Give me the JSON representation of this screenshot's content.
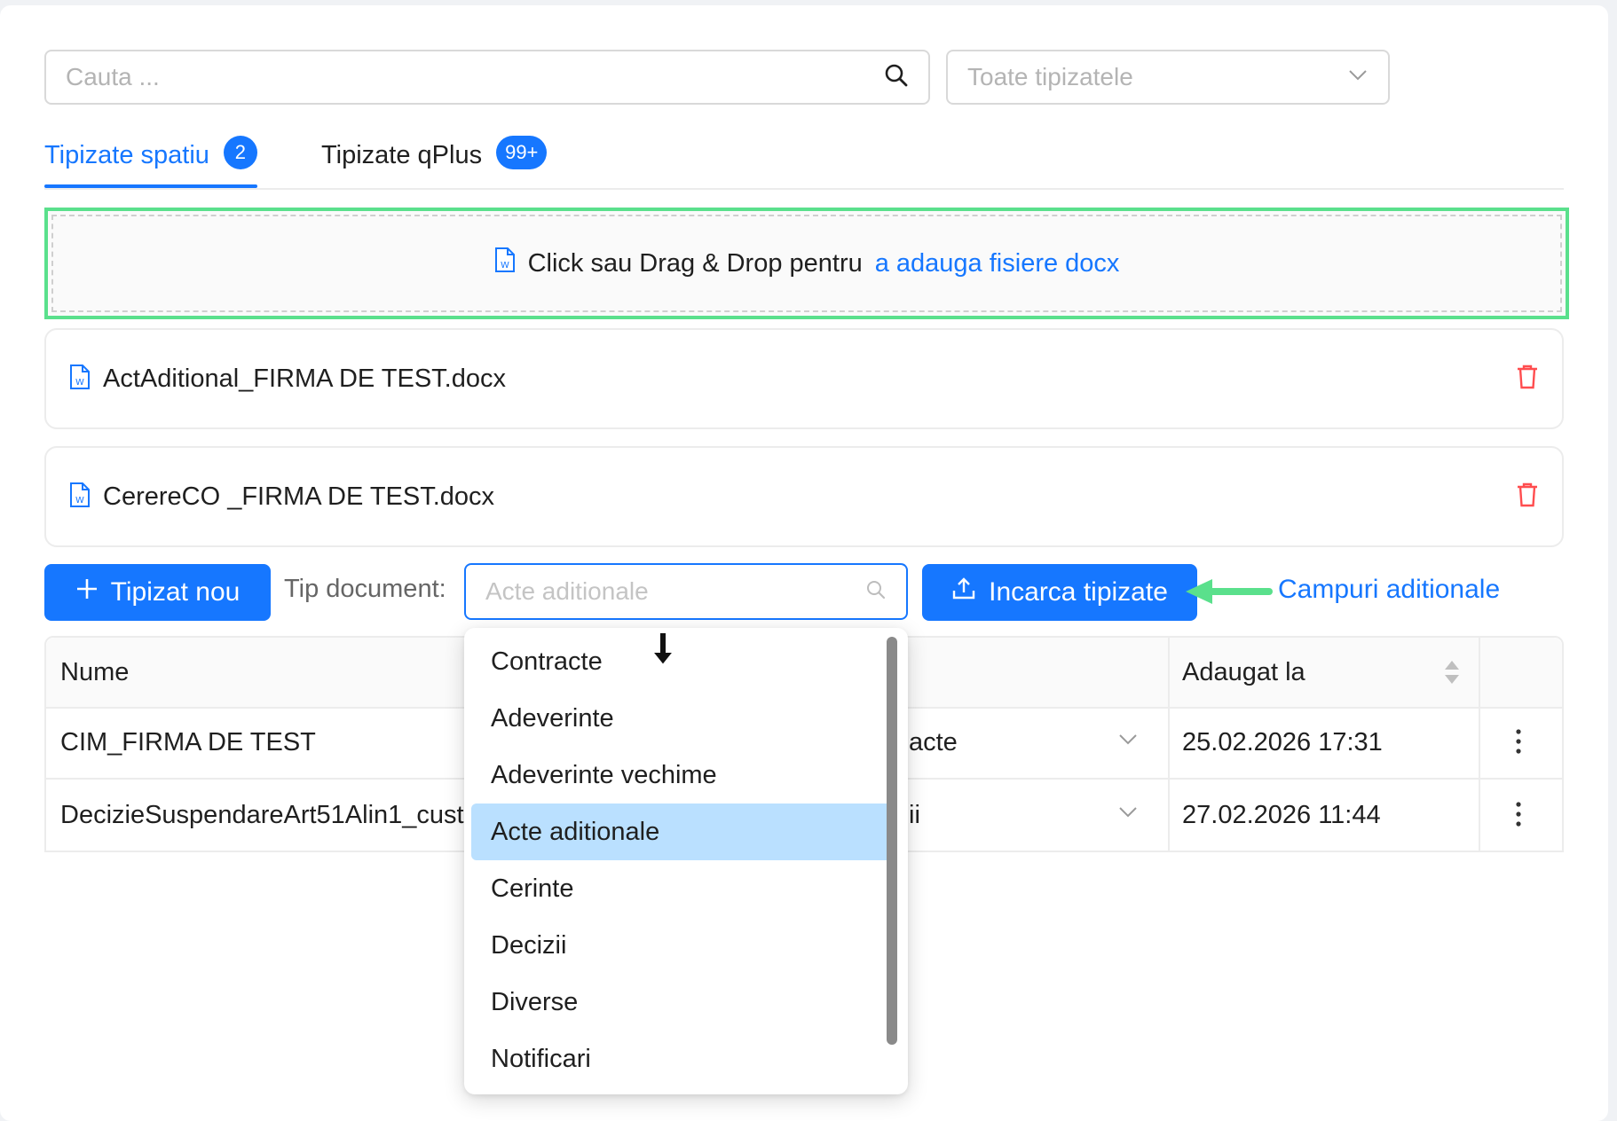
{
  "search": {
    "placeholder": "Cauta ..."
  },
  "type_filter": {
    "value": "Toate tipizatele"
  },
  "tabs": [
    {
      "label": "Tipizate spatiu",
      "badge": "2"
    },
    {
      "label": "Tipizate qPlus",
      "badge": "99+"
    }
  ],
  "dropzone": {
    "text": "Click sau Drag & Drop pentru",
    "link": "a adauga fisiere docx"
  },
  "files": [
    {
      "name": "ActAditional_FIRMA DE TEST.docx"
    },
    {
      "name": "CerereCO _FIRMA DE TEST.docx"
    }
  ],
  "toolbar": {
    "new_button": "Tipizat nou",
    "doc_type_label": "Tip document:",
    "doc_type_placeholder": "Acte aditionale",
    "upload_button": "Incarca tipizate",
    "extra_fields_link": "Campuri aditionale"
  },
  "table": {
    "headers": {
      "name": "Nume",
      "added": "Adaugat la"
    },
    "rows": [
      {
        "name": "CIM_FIRMA DE TEST",
        "type": "acte",
        "added": "25.02.2026 17:31"
      },
      {
        "name": "DecizieSuspendareArt51Alin1_cust",
        "type": "ii",
        "added": "27.02.2026 11:44"
      }
    ]
  },
  "dropdown": {
    "options": [
      "Contracte",
      "Adeverinte",
      "Adeverinte vechime",
      "Acte aditionale",
      "Cerinte",
      "Decizii",
      "Diverse",
      "Notificari"
    ],
    "selected": "Acte aditionale"
  },
  "colors": {
    "accent": "#1677ff",
    "danger": "#ff4d4f",
    "highlight": "#5ae08c",
    "selected_option": "#bae0ff"
  }
}
